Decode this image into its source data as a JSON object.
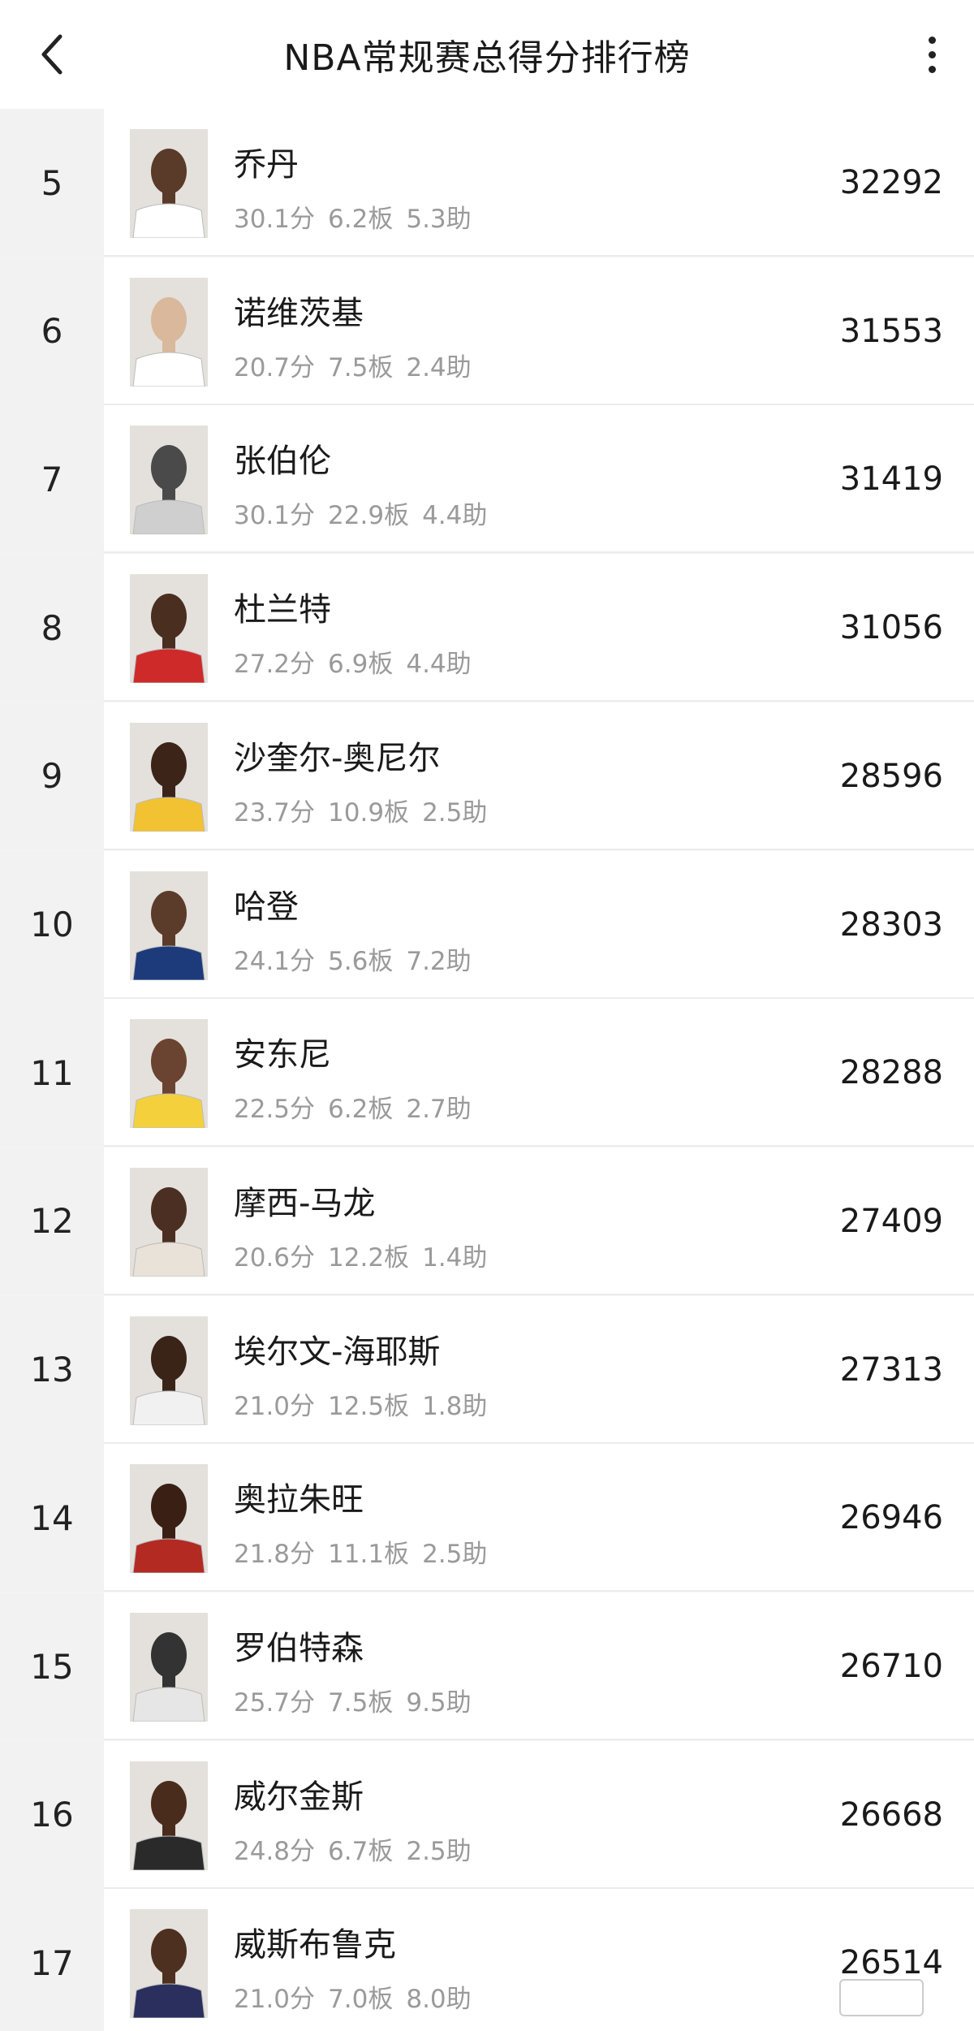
{
  "header": {
    "title": "NBA常规赛总得分排行榜"
  },
  "rows": [
    {
      "rank": "5",
      "name": "乔丹",
      "pts": "30.1分",
      "reb": "6.2板",
      "ast": "5.3助",
      "total": "32292",
      "jersey": "#ffffff",
      "skin": "#5a3a28"
    },
    {
      "rank": "6",
      "name": "诺维茨基",
      "pts": "20.7分",
      "reb": "7.5板",
      "ast": "2.4助",
      "total": "31553",
      "jersey": "#ffffff",
      "skin": "#d9b89c"
    },
    {
      "rank": "7",
      "name": "张伯伦",
      "pts": "30.1分",
      "reb": "22.9板",
      "ast": "4.4助",
      "total": "31419",
      "jersey": "#cfcfcf",
      "skin": "#4a4a4a"
    },
    {
      "rank": "8",
      "name": "杜兰特",
      "pts": "27.2分",
      "reb": "6.9板",
      "ast": "4.4助",
      "total": "31056",
      "jersey": "#ce2a2a",
      "skin": "#4a2e20"
    },
    {
      "rank": "9",
      "name": "沙奎尔-奥尼尔",
      "pts": "23.7分",
      "reb": "10.9板",
      "ast": "2.5助",
      "total": "28596",
      "jersey": "#f2c232",
      "skin": "#3d2418"
    },
    {
      "rank": "10",
      "name": "哈登",
      "pts": "24.1分",
      "reb": "5.6板",
      "ast": "7.2助",
      "total": "28303",
      "jersey": "#1d3b7a",
      "skin": "#5b3b2a"
    },
    {
      "rank": "11",
      "name": "安东尼",
      "pts": "22.5分",
      "reb": "6.2板",
      "ast": "2.7助",
      "total": "28288",
      "jersey": "#f4d13c",
      "skin": "#6a4430"
    },
    {
      "rank": "12",
      "name": "摩西-马龙",
      "pts": "20.6分",
      "reb": "12.2板",
      "ast": "1.4助",
      "total": "27409",
      "jersey": "#e8e2d8",
      "skin": "#4b2f22"
    },
    {
      "rank": "13",
      "name": "埃尔文-海耶斯",
      "pts": "21.0分",
      "reb": "12.5板",
      "ast": "1.8助",
      "total": "27313",
      "jersey": "#f1f1f1",
      "skin": "#3a2418"
    },
    {
      "rank": "14",
      "name": "奥拉朱旺",
      "pts": "21.8分",
      "reb": "11.1板",
      "ast": "2.5助",
      "total": "26946",
      "jersey": "#b22a22",
      "skin": "#3a2014"
    },
    {
      "rank": "15",
      "name": "罗伯特森",
      "pts": "25.7分",
      "reb": "7.5板",
      "ast": "9.5助",
      "total": "26710",
      "jersey": "#e6e6e6",
      "skin": "#333333"
    },
    {
      "rank": "16",
      "name": "威尔金斯",
      "pts": "24.8分",
      "reb": "6.7板",
      "ast": "2.5助",
      "total": "26668",
      "jersey": "#2a2a2a",
      "skin": "#4a2c1c"
    },
    {
      "rank": "17",
      "name": "威斯布鲁克",
      "pts": "21.0分",
      "reb": "7.0板",
      "ast": "8.0助",
      "total": "26514",
      "jersey": "#2b2f5e",
      "skin": "#4e3020"
    }
  ]
}
